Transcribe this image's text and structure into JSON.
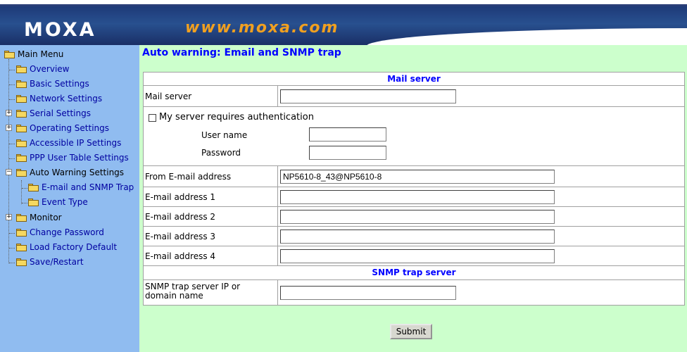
{
  "header": {
    "logo": "MOXA",
    "url": "www.moxa.com"
  },
  "sidebar": {
    "items": [
      {
        "label": "Main Menu"
      },
      {
        "label": "Overview"
      },
      {
        "label": "Basic Settings"
      },
      {
        "label": "Network Settings"
      },
      {
        "label": "Serial Settings"
      },
      {
        "label": "Operating Settings"
      },
      {
        "label": "Accessible IP Settings"
      },
      {
        "label": "PPP User Table Settings"
      },
      {
        "label": "Auto Warning Settings"
      },
      {
        "label": "E-mail and SNMP Trap"
      },
      {
        "label": "Event Type"
      },
      {
        "label": "Monitor"
      },
      {
        "label": "Change Password"
      },
      {
        "label": "Load Factory Default"
      },
      {
        "label": "Save/Restart"
      }
    ]
  },
  "main": {
    "title": "Auto warning: Email and SNMP trap",
    "mail_section": "Mail server",
    "mail_server_label": "Mail server",
    "mail_server_value": "",
    "auth_label": "My server requires authentication",
    "auth_checked": false,
    "user_name_label": "User name",
    "user_name_value": "",
    "password_label": "Password",
    "password_value": "",
    "from_label": "From E-mail address",
    "from_value": "NP5610-8_43@NP5610-8",
    "email1_label": "E-mail address 1",
    "email1_value": "",
    "email2_label": "E-mail address 2",
    "email2_value": "",
    "email3_label": "E-mail address 3",
    "email3_value": "",
    "email4_label": "E-mail address 4",
    "email4_value": "",
    "snmp_section": "SNMP trap server",
    "snmp_label": "SNMP trap server IP or domain name",
    "snmp_value": "",
    "submit_label": "Submit"
  },
  "colors": {
    "sidebar_bg": "#90bcf0",
    "main_bg": "#ccffcc",
    "title_color": "#0000ff",
    "link_color": "#0000a0",
    "header_band": "#1e3a78",
    "url_color": "#f0a020"
  }
}
